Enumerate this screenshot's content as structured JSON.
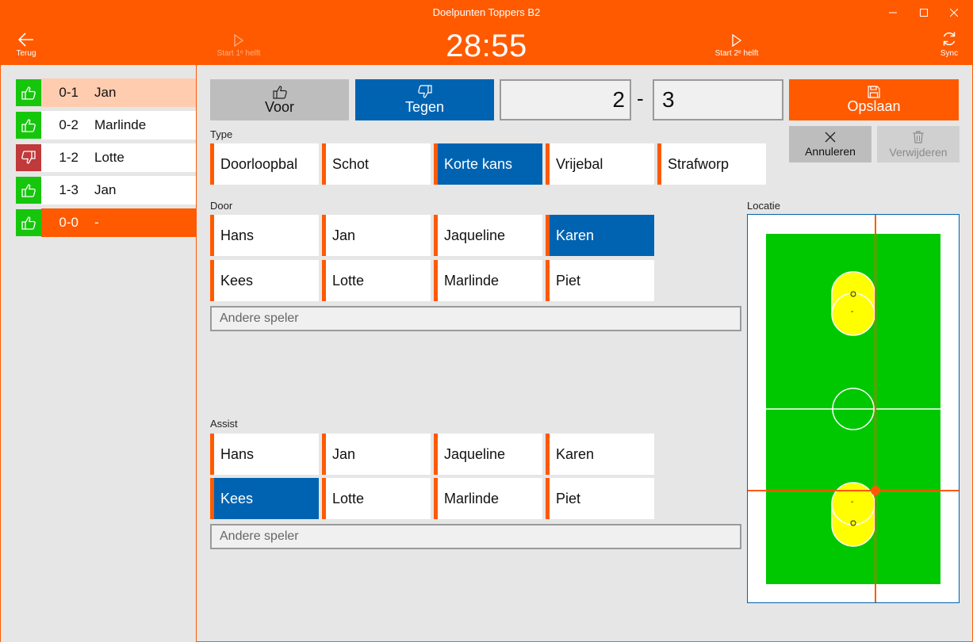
{
  "window": {
    "title": "Doelpunten Toppers B2"
  },
  "commands": {
    "back": "Terug",
    "start_first": "Start 1ᵉ helft",
    "start_second": "Start 2ᵉ helft",
    "sync": "Sync",
    "clock": "28:55"
  },
  "goals": [
    {
      "score": "0-1",
      "player": "Jan",
      "kind": "voor"
    },
    {
      "score": "0-2",
      "player": "Marlinde",
      "kind": "voor"
    },
    {
      "score": "1-2",
      "player": "Lotte",
      "kind": "tegen"
    },
    {
      "score": "1-3",
      "player": "Jan",
      "kind": "voor"
    },
    {
      "score": "0-0",
      "player": "-",
      "kind": "voor"
    }
  ],
  "editor": {
    "voor_label": "Voor",
    "tegen_label": "Tegen",
    "score_home": "2",
    "score_sep": "-",
    "score_away": "3",
    "save_label": "Opslaan",
    "cancel_label": "Annuleren",
    "delete_label": "Verwijderen"
  },
  "type": {
    "label": "Type",
    "options": [
      "Doorloopbal",
      "Schot",
      "Korte kans",
      "Vrijebal",
      "Strafworp"
    ],
    "selected": "Korte kans"
  },
  "door": {
    "label": "Door",
    "players": [
      "Hans",
      "Jan",
      "Jaqueline",
      "Karen",
      "Kees",
      "Lotte",
      "Marlinde",
      "Piet"
    ],
    "selected": "Karen",
    "other_placeholder": "Andere speler"
  },
  "assist": {
    "label": "Assist",
    "players": [
      "Hans",
      "Jan",
      "Jaqueline",
      "Karen",
      "Kees",
      "Lotte",
      "Marlinde",
      "Piet"
    ],
    "selected": "Kees",
    "other_placeholder": "Andere speler"
  },
  "location": {
    "label": "Locatie",
    "zone_marks": [
      "-",
      "-"
    ]
  },
  "colors": {
    "accent": "#ff5a00",
    "selected": "#0063b1",
    "voor": "#16c60c",
    "tegen": "#c0393b",
    "field": "#00c800",
    "zone": "#ffff00",
    "row_highlight": "#ffccb0"
  }
}
